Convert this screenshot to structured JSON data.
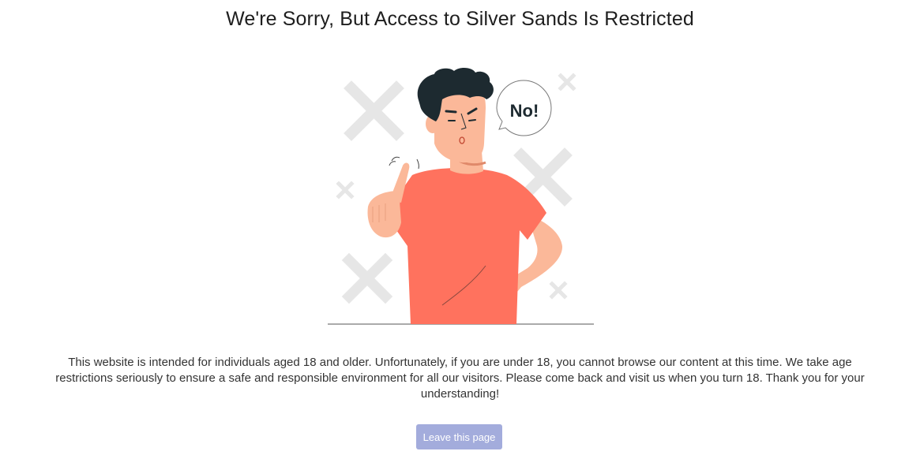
{
  "page": {
    "title": "We're Sorry, But Access to Silver Sands Is Restricted",
    "message": "This website is intended for individuals aged 18 and older. Unfortunately, if you are under 18, you cannot browse our content at this time. We take age restrictions seriously to ensure a safe and responsible environment for all our visitors. Please come back and visit us when you turn 18. Thank you for your understanding!",
    "illustration": {
      "speech_bubble_text": "No!",
      "icon": "person-saying-no-illustration"
    },
    "leave_button_label": "Leave this page"
  },
  "colors": {
    "button_bg": "#a3acdc",
    "shirt": "#ff725e",
    "skin": "#fbb899",
    "hair": "#1d2a30",
    "x_marks": "#e6e6e6"
  }
}
